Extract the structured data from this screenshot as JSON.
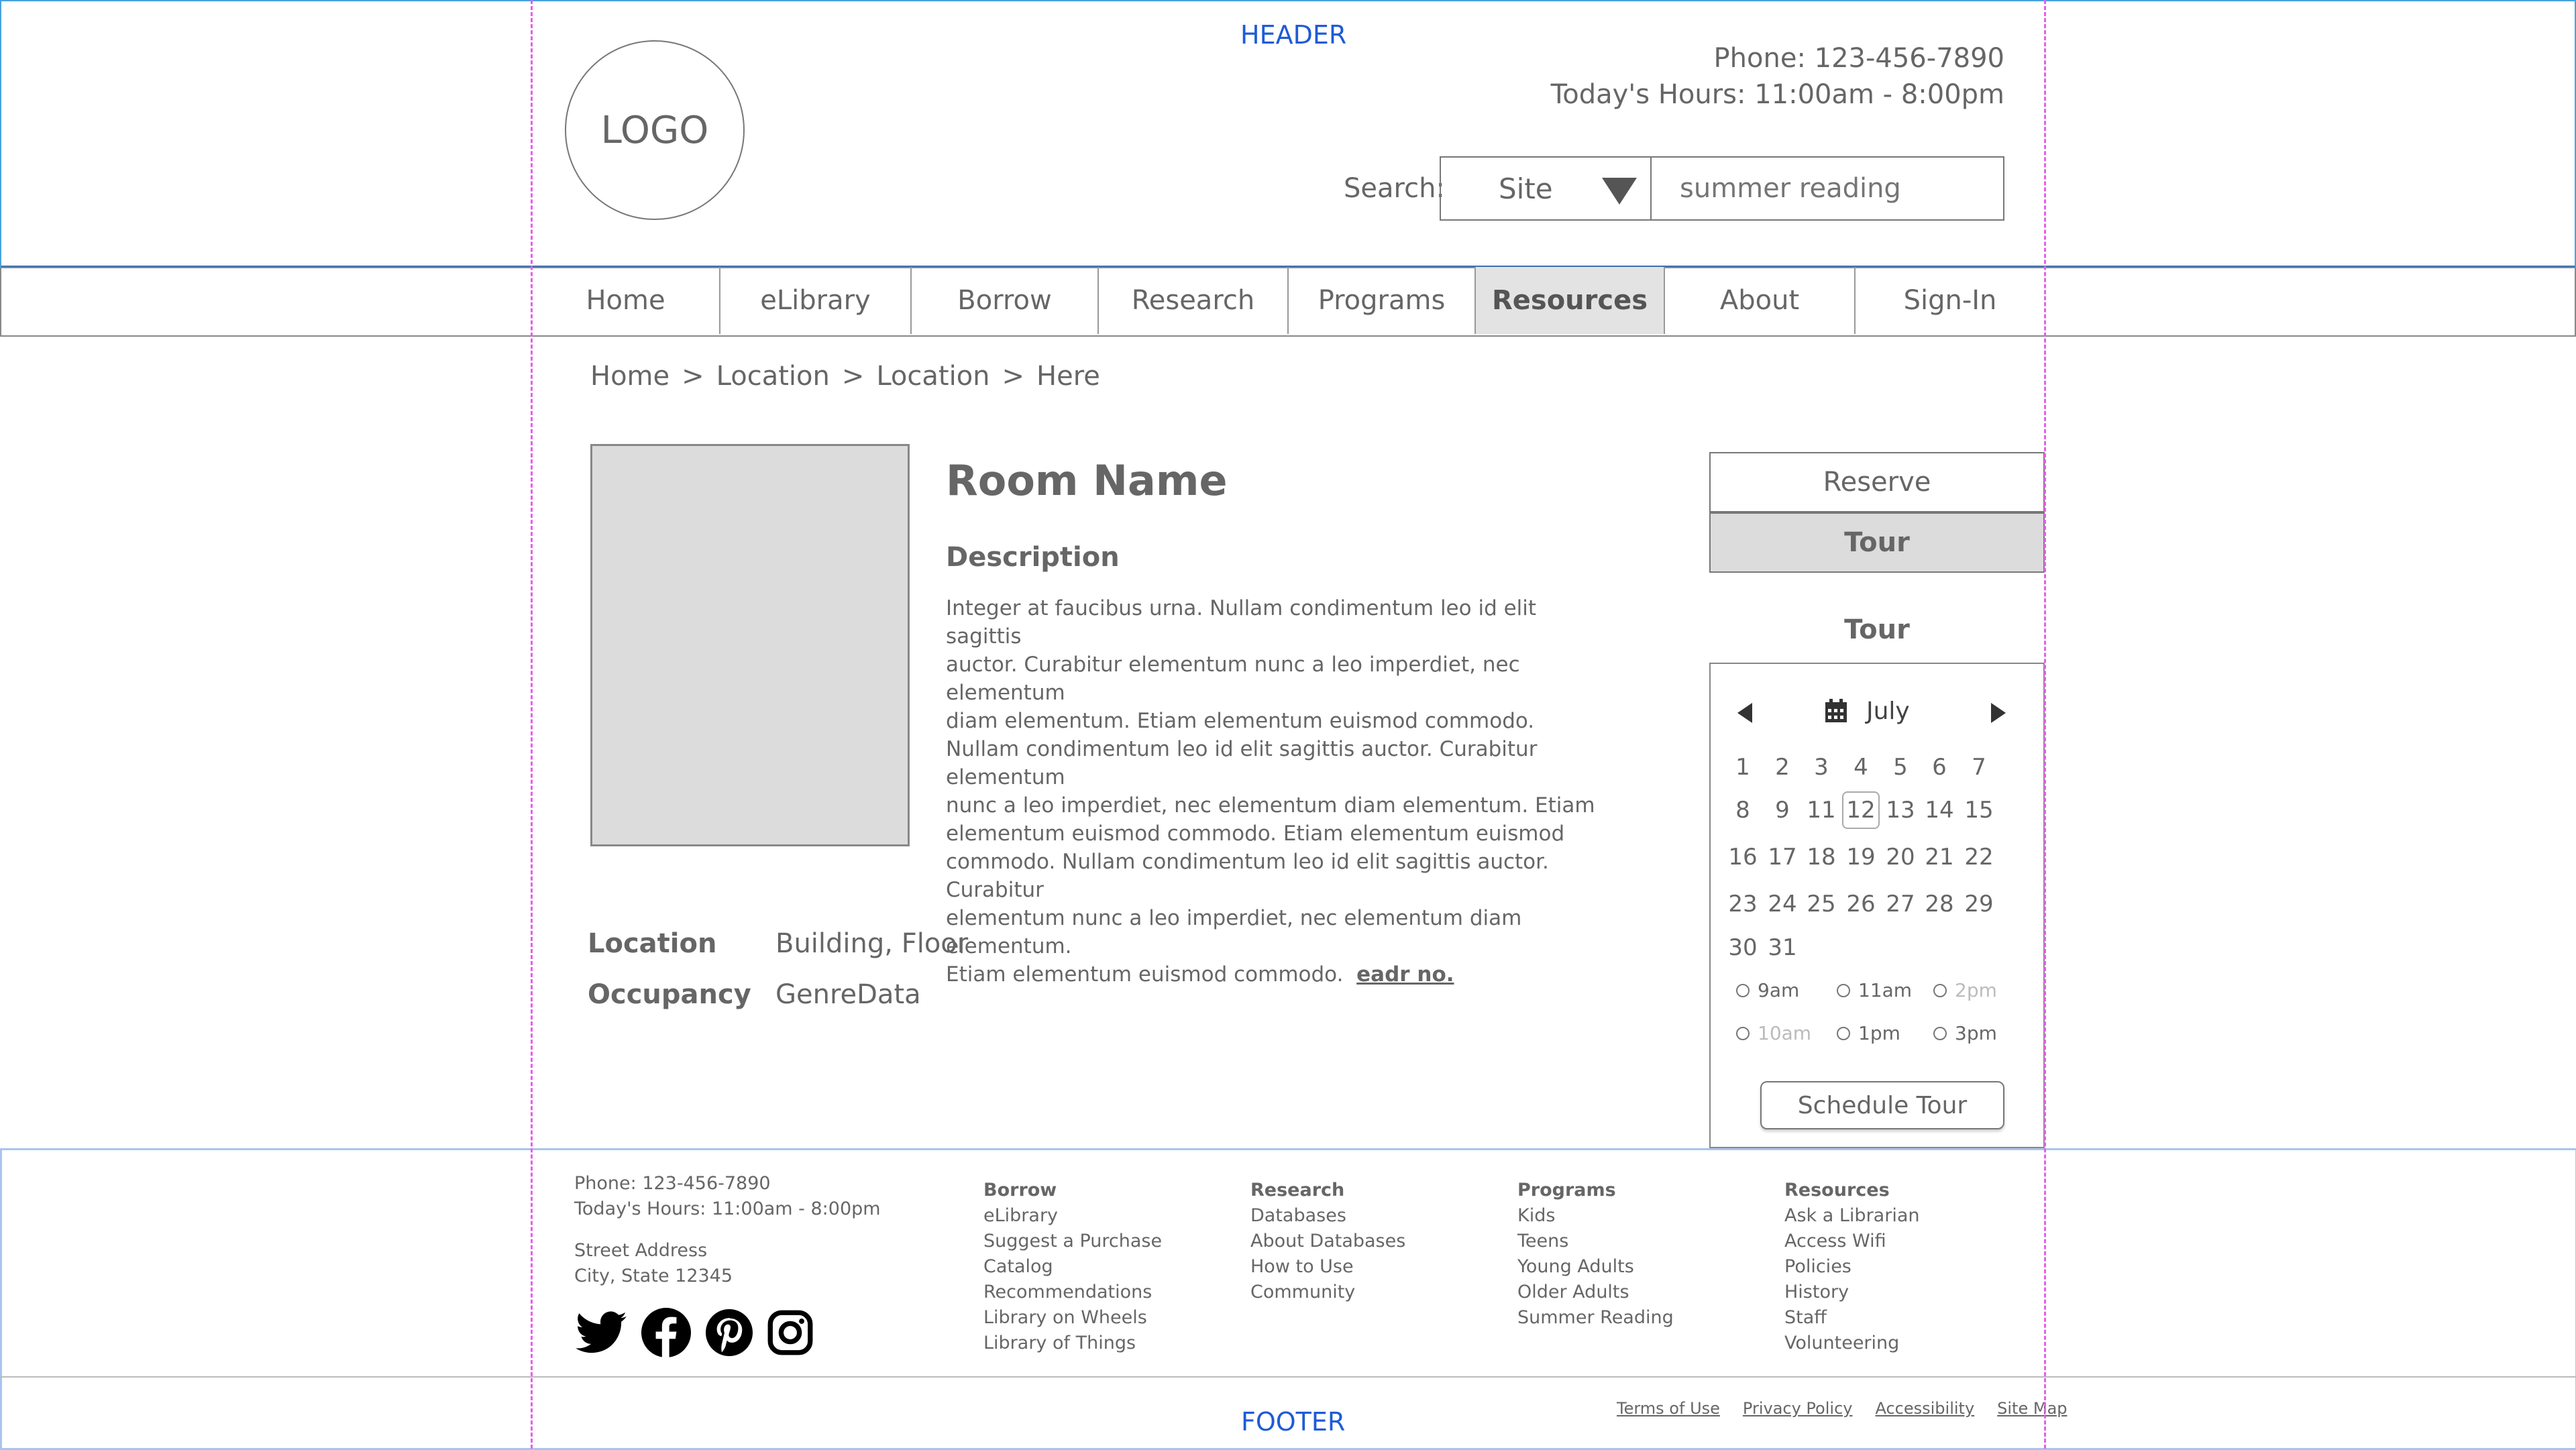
{
  "header": {
    "label": "HEADER",
    "logo": "LOGO",
    "phone": "Phone: 123-456-7890",
    "hours": "Today's Hours:  11:00am - 8:00pm",
    "search_label": "Search:",
    "search_scope": "Site",
    "search_placeholder": "summer reading"
  },
  "nav": {
    "items": [
      "Home",
      "eLibrary",
      "Borrow",
      "Research",
      "Programs",
      "Resources",
      "About",
      "Sign-In"
    ],
    "active": "Resources"
  },
  "breadcrumb": {
    "items": [
      "Home",
      "Location",
      "Location",
      "Here"
    ],
    "separator": ">"
  },
  "room": {
    "name": "Room Name",
    "description_heading": "Description",
    "description_lines": [
      "Integer at faucibus urna. Nullam condimentum leo id elit sagittis",
      "auctor. Curabitur elementum nunc a leo imperdiet, nec elementum",
      "diam elementum. Etiam elementum euismod commodo.",
      "Nullam condimentum leo id elit sagittis auctor. Curabitur elementum",
      "nunc a leo imperdiet, nec elementum diam elementum. Etiam",
      "elementum euismod commodo. Etiam elementum euismod",
      "commodo.  Nullam condimentum leo id elit sagittis auctor. Curabitur",
      "elementum nunc a leo imperdiet, nec elementum diam elementum.",
      "Etiam elementum euismod commodo."
    ],
    "read_more": "eadr no.",
    "location_label": "Location",
    "location_value": "Building, Floor",
    "occupancy_label": "Occupancy",
    "occupancy_value": "GenreData"
  },
  "actions": {
    "reserve": "Reserve",
    "tour": "Tour"
  },
  "tour": {
    "title": "Tour",
    "month": "July",
    "selected_day": 12,
    "weeks": [
      [
        "1",
        "2",
        "3",
        "4",
        "5",
        "6",
        "7"
      ],
      [
        "8",
        "9",
        "11",
        "12",
        "13",
        "14",
        "15"
      ],
      [
        "16",
        "17",
        "18",
        "19",
        "20",
        "21",
        "22"
      ],
      [
        "23",
        "24",
        "25",
        "26",
        "27",
        "28",
        "29"
      ],
      [
        "30",
        "31"
      ]
    ],
    "slots": [
      {
        "label": "9am",
        "enabled": true
      },
      {
        "label": "11am",
        "enabled": true
      },
      {
        "label": "2pm",
        "enabled": false
      },
      {
        "label": "10am",
        "enabled": false
      },
      {
        "label": "1pm",
        "enabled": true
      },
      {
        "label": "3pm",
        "enabled": true
      }
    ],
    "schedule_button": "Schedule Tour"
  },
  "footer": {
    "label": "FOOTER",
    "phone": "Phone: 123-456-7890",
    "hours": "Today's Hours:  11:00am - 8:00pm",
    "street": "Street Address",
    "city": "City, State 12345",
    "social_icons": [
      "twitter-icon",
      "facebook-icon",
      "pinterest-icon",
      "instagram-icon"
    ],
    "columns": [
      {
        "heading": "Borrow",
        "links": [
          "eLibrary",
          "Suggest a Purchase",
          "Catalog",
          "Recommendations",
          "Library on Wheels",
          "Library of Things"
        ]
      },
      {
        "heading": "Research",
        "links": [
          "Databases",
          "About Databases",
          "How to Use",
          "Community"
        ]
      },
      {
        "heading": "Programs",
        "links": [
          "Kids",
          "Teens",
          "Young Adults",
          "Older Adults",
          "Summer Reading"
        ]
      },
      {
        "heading": "Resources",
        "links": [
          "Ask a Librarian",
          "Access Wifi",
          "Policies",
          "History",
          "Staff",
          "Volunteering"
        ]
      }
    ],
    "legal_links": [
      "Terms of Use",
      "Privacy Policy",
      "Accessibility",
      "Site Map"
    ]
  },
  "colors": {
    "header_border": "#4aa3df",
    "guide": "#e85ee8",
    "label_blue": "#1e5bd6",
    "active_tab_bg": "#e3e3e3",
    "placeholder_bg": "#dcdcdc"
  }
}
